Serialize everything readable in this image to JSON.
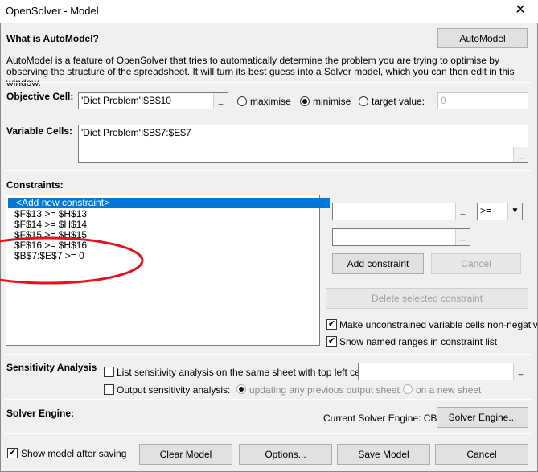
{
  "window": {
    "title": "OpenSolver - Model",
    "close_symbol": "✕"
  },
  "automodel": {
    "heading": "What is AutoModel?",
    "button": "AutoModel",
    "description": "AutoModel is a feature of OpenSolver that tries to automatically determine the problem you are trying to optimise by observing the structure of the spreadsheet. It will turn its best guess into a Solver model, which you can then edit in this window."
  },
  "objective": {
    "label": "Objective Cell:",
    "value": "'Diet Problem'!$B$10",
    "ref_button": "_",
    "options": [
      "maximise",
      "minimise",
      "target value:"
    ],
    "selected": "minimise",
    "target_value": "0"
  },
  "variables": {
    "label": "Variable Cells:",
    "value": "'Diet Problem'!$B$7:$E$7",
    "ref_button": "_"
  },
  "constraints": {
    "label": "Constraints:",
    "items": [
      "<Add new constraint>",
      "$F$13 >= $H$13",
      "$F$14 >= $H$14",
      "$F$15 >= $H$15",
      "$F$16 >= $H$16",
      "$B$7:$E$7 >= 0"
    ],
    "selected_index": 0,
    "lhs_value": "",
    "rhs_value": "",
    "operator": ">=",
    "ref_button": "_",
    "dropdown_symbol": "▼",
    "add_button": "Add constraint",
    "cancel_button": "Cancel",
    "delete_button": "Delete selected constraint",
    "nonneg_label": "Make unconstrained variable cells non-negative",
    "nonneg_checked": true,
    "named_ranges_label": "Show named ranges in constraint list",
    "named_ranges_checked": true,
    "annotation_color": "#e0141e"
  },
  "sensitivity": {
    "label": "Sensitivity Analysis",
    "list_label": "List sensitivity analysis on the same sheet with top left cell:",
    "list_checked": false,
    "list_value": "",
    "ref_button": "_",
    "output_label": "Output sensitivity analysis:",
    "output_checked": false,
    "opt_updating": "updating any previous output sheet",
    "opt_new_sheet": "on a new sheet"
  },
  "engine": {
    "label": "Solver Engine:",
    "current": "Current Solver Engine: CBC",
    "button": "Solver Engine..."
  },
  "footer": {
    "show_model_label": "Show model after saving",
    "show_model_checked": true,
    "clear_button": "Clear Model",
    "options_button": "Options...",
    "save_button": "Save Model",
    "cancel_button": "Cancel"
  },
  "check_mark": "✔"
}
